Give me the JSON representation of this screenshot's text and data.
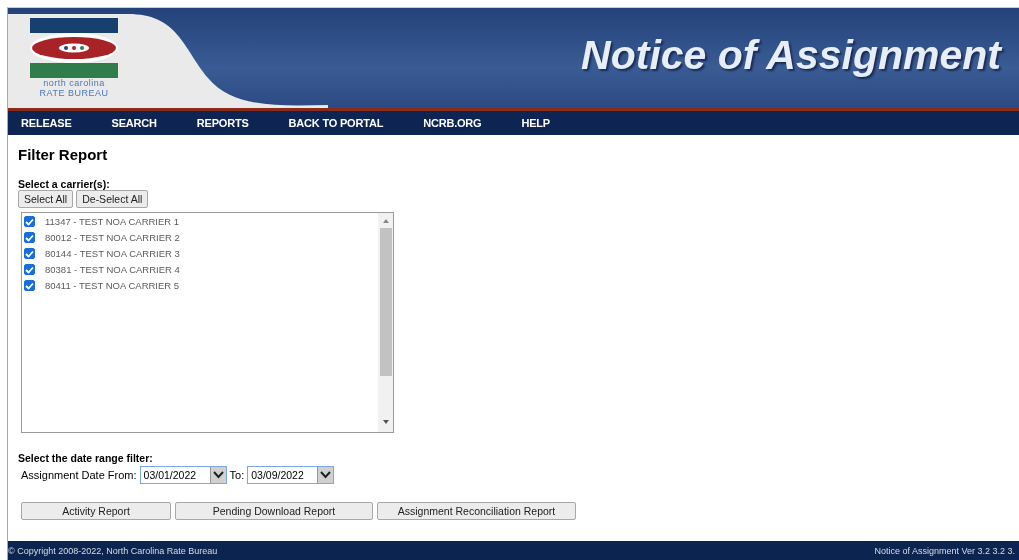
{
  "header": {
    "logo_lines": [
      "north carolina",
      "RATE BUREAU"
    ],
    "title": "Notice of Assignment"
  },
  "nav": [
    "RELEASE",
    "SEARCH",
    "REPORTS",
    "BACK TO PORTAL",
    "NCRB.ORG",
    "HELP"
  ],
  "filter": {
    "title": "Filter Report",
    "carrier_label": "Select a carrier(s):",
    "select_buttons": [
      "Select All",
      "De-Select All"
    ],
    "carriers": [
      {
        "label": "11347 - TEST NOA CARRIER 1",
        "checked": true
      },
      {
        "label": "80012 - TEST NOA CARRIER 2",
        "checked": true
      },
      {
        "label": "80144 - TEST NOA CARRIER 3",
        "checked": true
      },
      {
        "label": "80381 - TEST NOA CARRIER 4",
        "checked": true
      },
      {
        "label": "80411 - TEST NOA CARRIER 5",
        "checked": true
      }
    ],
    "date_label": "Select the date range filter:",
    "from_label": "Assignment Date From:",
    "from_value": "03/01/2022",
    "to_label": "To:",
    "to_value": "03/09/2022"
  },
  "report_buttons": [
    "Activity Report",
    "Pending Download Report",
    "Assignment Reconciliation Report"
  ],
  "footer": {
    "copyright": "© Copyright 2008-2022, North Carolina Rate Bureau",
    "version": "Notice of Assignment Ver 3.2 3.2 3."
  }
}
